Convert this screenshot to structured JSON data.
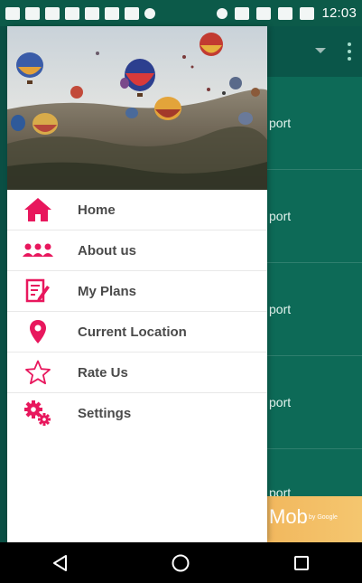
{
  "status_bar": {
    "time": "12:03"
  },
  "background_app": {
    "rows": [
      "port",
      "port",
      "port",
      "port",
      "port"
    ],
    "ad_text": "Mob",
    "ad_sub": "by Google"
  },
  "drawer": {
    "menu": [
      {
        "label": "Home",
        "icon": "home-icon"
      },
      {
        "label": "About us",
        "icon": "group-icon"
      },
      {
        "label": "My Plans",
        "icon": "edit-note-icon"
      },
      {
        "label": "Current Location",
        "icon": "location-pin-icon"
      },
      {
        "label": "Rate Us",
        "icon": "star-icon"
      },
      {
        "label": "Settings",
        "icon": "gear-icon"
      }
    ]
  },
  "colors": {
    "accent": "#e8175d",
    "primary_dark": "#0c5a49",
    "primary": "#0d6a57"
  }
}
